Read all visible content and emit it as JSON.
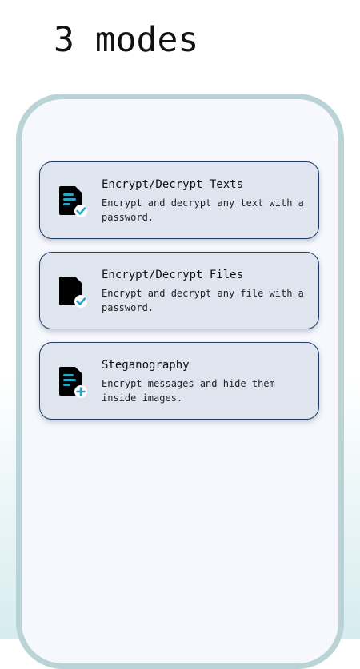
{
  "headline": "3 modes",
  "colors": {
    "accent": "#2aa6c4",
    "card_background": "#dfe5ef",
    "card_border": "#1f3b66",
    "frame": "#b9d3d6"
  },
  "modes": [
    {
      "title": "Encrypt/Decrypt Texts",
      "description": "Encrypt and decrypt any text with a password.",
      "icon": "document-lines-check-icon"
    },
    {
      "title": "Encrypt/Decrypt Files",
      "description": "Encrypt and decrypt any file with a password.",
      "icon": "document-check-icon"
    },
    {
      "title": "Steganography",
      "description": "Encrypt messages and hide them inside images.",
      "icon": "document-lines-plus-icon"
    }
  ]
}
